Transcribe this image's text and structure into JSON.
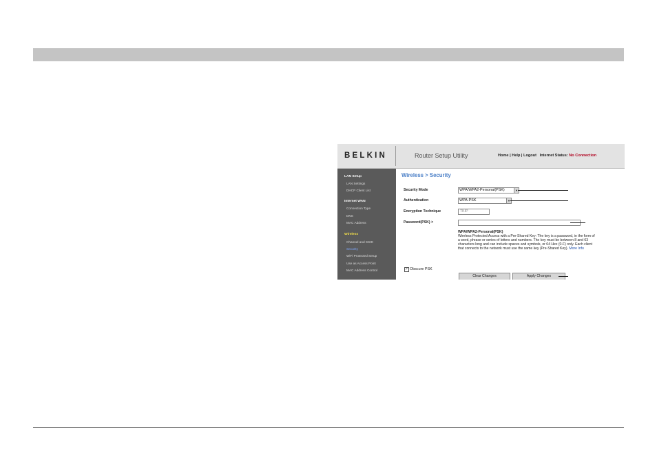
{
  "header": {
    "logo": "BELKIN",
    "app_title": "Router Setup Utility",
    "links": [
      "Home",
      "Help",
      "Logout"
    ],
    "status_label": "Internet Status:",
    "status_value": "No Connection"
  },
  "sidebar": {
    "sections": [
      {
        "title": "LAN Setup",
        "items": [
          "LAN Settings",
          "DHCP Client List"
        ]
      },
      {
        "title": "Internet WAN",
        "items": [
          "Connection Type",
          "DNS",
          "MAC Address"
        ]
      },
      {
        "title": "Wireless",
        "items": [
          "Channel and SSID",
          "Security",
          "WiFi Protected Setup",
          "Use as Access Point",
          "MAC Address Control"
        ]
      }
    ],
    "active_section": "Wireless",
    "active_item": "Security"
  },
  "main": {
    "title": "Wireless > Security",
    "security_mode_label": "Security Mode",
    "security_mode_value": "WPA/WPA2-Personal(PSK)",
    "authentication_label": "Authentication",
    "authentication_value": "WPA-PSK",
    "encryption_label": "Encryption Technique",
    "encryption_value": "TKIP",
    "password_label": "Password(PSK) >",
    "password_value": "",
    "desc_title": "WPA/WPA2-Personal(PSK)",
    "desc_text": "Wireless Protected Access with a Pre-Shared Key: The key is a password, in the form of a word, phrase or series of letters and numbers. The key must be between 8 and 63 characters long and can include spaces and symbols, or 64 Hex (0-F) only. Each client that connects to the network must use the same key (Pre-Shared Key).",
    "more_info": "More Info",
    "obscure_label": "Obscure PSK",
    "obscure_checked": true,
    "clear_label": "Clear Changes",
    "apply_label": "Apply Changes"
  }
}
